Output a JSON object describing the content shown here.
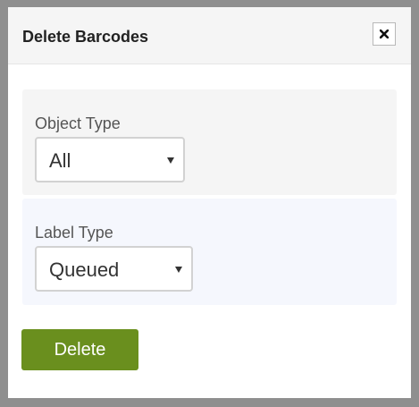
{
  "dialog": {
    "title": "Delete Barcodes",
    "close_icon": "close-icon"
  },
  "object_type": {
    "label": "Object Type",
    "selected": "All",
    "arrow_icon": "dropdown-arrow-icon"
  },
  "label_type": {
    "label": "Label Type",
    "selected": "Queued",
    "arrow_icon": "dropdown-arrow-icon"
  },
  "actions": {
    "delete_label": "Delete"
  },
  "colors": {
    "backdrop": "#8f8f8f",
    "header_bg": "#f5f5f5",
    "object_panel_bg": "#f5f5f5",
    "label_panel_bg": "#f5f7fd",
    "delete_button": "#6a8f1e"
  }
}
